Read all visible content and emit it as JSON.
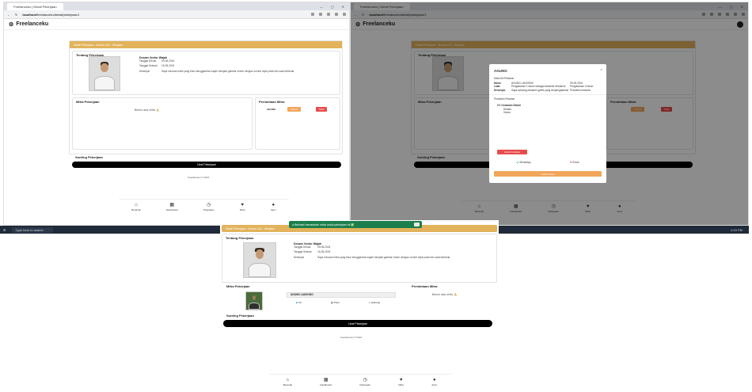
{
  "browser": {
    "tab_title": "Freelanceku | Detail Pekerjaan",
    "url_host": "localhost",
    "url_path": "/freelanceku/detail/pekerjaan/1"
  },
  "app": {
    "brand": "Freelanceku"
  },
  "job": {
    "header": "Detail Pekerjaan - Nomor #12 - Berjalan",
    "section_title": "Tentang Pekerjaan",
    "title": "Desain Vector Wajah",
    "start_label": "Tanggal Dibuat",
    "start_value": "09-08-2024",
    "deadline_label": "Tanggal Selesai",
    "deadline_value": "15-08-2024",
    "desc_label": "Deskripsi",
    "desc_value": "Saya mencari mitra yang bisa menggambar wajah menjadi gambar vector dengan contoh style pada foto saat berbeda"
  },
  "mitra": {
    "section_title": "Mitra Pekerjaan",
    "empty_text": "Belum ada mitra 🙏"
  },
  "permintaan": {
    "section_title": "Permintaan Mitra",
    "name": "AGUNG",
    "accept_label": "Terima",
    "reject_label": "Tolak"
  },
  "edit": {
    "section_title": "Sunting Pekerjaan",
    "button_label": "Lihat Pekerjaan"
  },
  "footer": {
    "text": "Freelanceku © 2024"
  },
  "nav": [
    {
      "label": "Beranda",
      "icon": "home-icon",
      "glyph": "⌂"
    },
    {
      "label": "Dashboard",
      "icon": "grid-icon",
      "glyph": "▦"
    },
    {
      "label": "Pekerjaan",
      "icon": "clock-icon",
      "glyph": "◷"
    },
    {
      "label": "Mitra",
      "icon": "heart-icon",
      "glyph": "♥"
    },
    {
      "label": "Akun",
      "icon": "user-icon",
      "glyph": "●"
    }
  ],
  "modal": {
    "title": "AGUNG",
    "section": "Data Diri Pelamar",
    "rows": [
      {
        "k": "Nama",
        "v": "AGUNG LAKSONO",
        "k2": "Tanggal Lahir",
        "v2": "09-09-2001"
      },
      {
        "k": "Latar",
        "v": "Pengalaman 1 tahun sebagai desainer freelance",
        "k2": "",
        "v2": "Pengalaman 3 tahun"
      },
      {
        "k": "Deskripsi",
        "v": "Saya seorang desainer grafis yang berpengalaman",
        "k2": "",
        "v2": "Portofolio tersedia"
      }
    ],
    "portfolio": "Portofolio Pelamar",
    "cv_title": "CV Gunawan Sakuli",
    "cv_sub1": "Desain",
    "cv_sub2": "Vector",
    "cv_btn": "Lihat Portofolio",
    "wa": "WhatsApp",
    "email": "Email",
    "accept": "Terima Mitra"
  },
  "toast": {
    "text": "Berhasil menambah mitra untuk pekerjaan ini ✅"
  },
  "mitraC": {
    "name": "AGUNG LAKSONO",
    "p1": "CV",
    "p2": "Porto",
    "p3": "Hubungi"
  },
  "taskbar": {
    "search": "Type here to search",
    "clock": "4:15 PM"
  },
  "colors": {
    "accent": "#e2b35b",
    "toast": "#1b7f4d",
    "accept": "#f2a65a",
    "reject": "#e74c4c"
  }
}
